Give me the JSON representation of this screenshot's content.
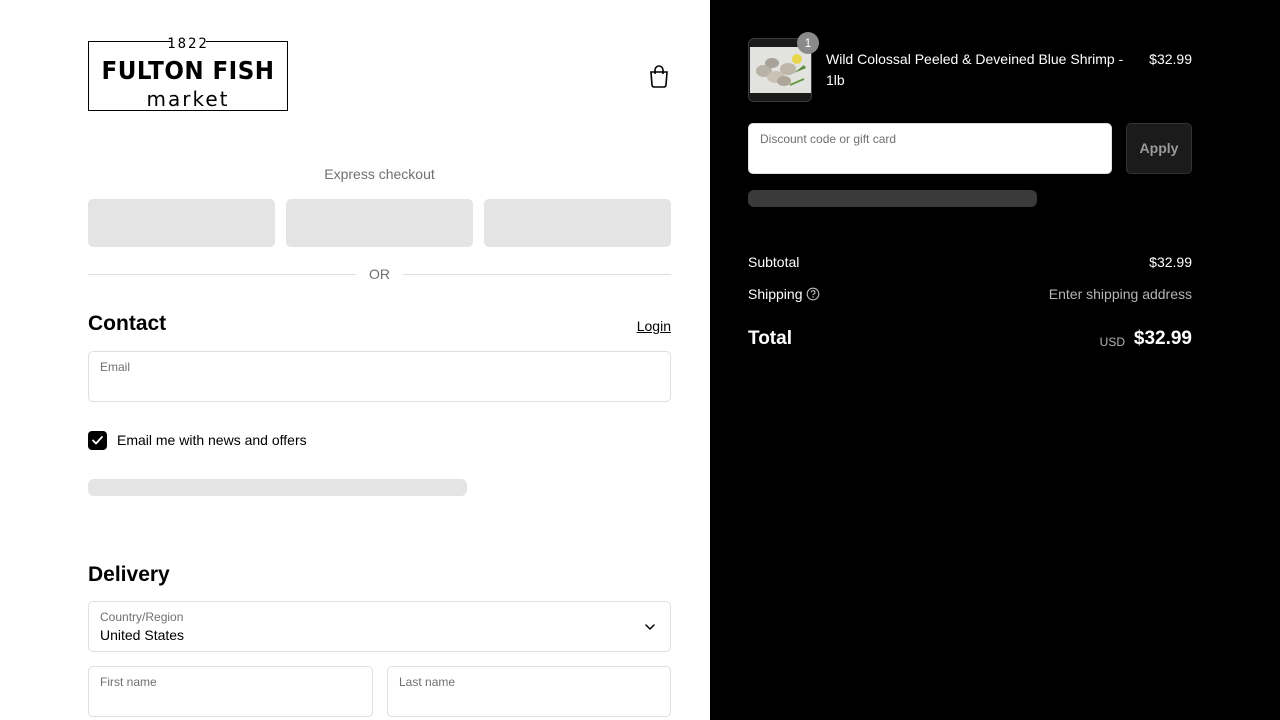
{
  "logo": {
    "year": "1822",
    "name": "FULTON FISH",
    "sub": "market"
  },
  "express": {
    "label": "Express checkout",
    "or": "OR"
  },
  "contact": {
    "title": "Contact",
    "login": "Login",
    "email_label": "Email",
    "email_value": "",
    "newsletter_label": "Email me with news and offers",
    "newsletter_checked": true
  },
  "delivery": {
    "title": "Delivery",
    "country_label": "Country/Region",
    "country_value": "United States",
    "first_name_label": "First name",
    "last_name_label": "Last name"
  },
  "summary": {
    "item": {
      "quantity": "1",
      "name": "Wild Colossal Peeled & Deveined Blue Shrimp - 1lb",
      "price": "$32.99"
    },
    "discount_label": "Discount code or gift card",
    "apply": "Apply",
    "subtotal_label": "Subtotal",
    "subtotal_value": "$32.99",
    "shipping_label": "Shipping",
    "shipping_value": "Enter shipping address",
    "total_label": "Total",
    "total_currency": "USD",
    "total_value": "$32.99"
  },
  "colors": {
    "summary_bg": "#000000",
    "accent": "#000000",
    "skeleton_light": "#e4e4e4",
    "skeleton_dark": "#3a3a3a"
  },
  "icons": [
    "cart-bag-icon",
    "checkmark-icon",
    "chevron-down-icon",
    "help-circle-icon"
  ]
}
